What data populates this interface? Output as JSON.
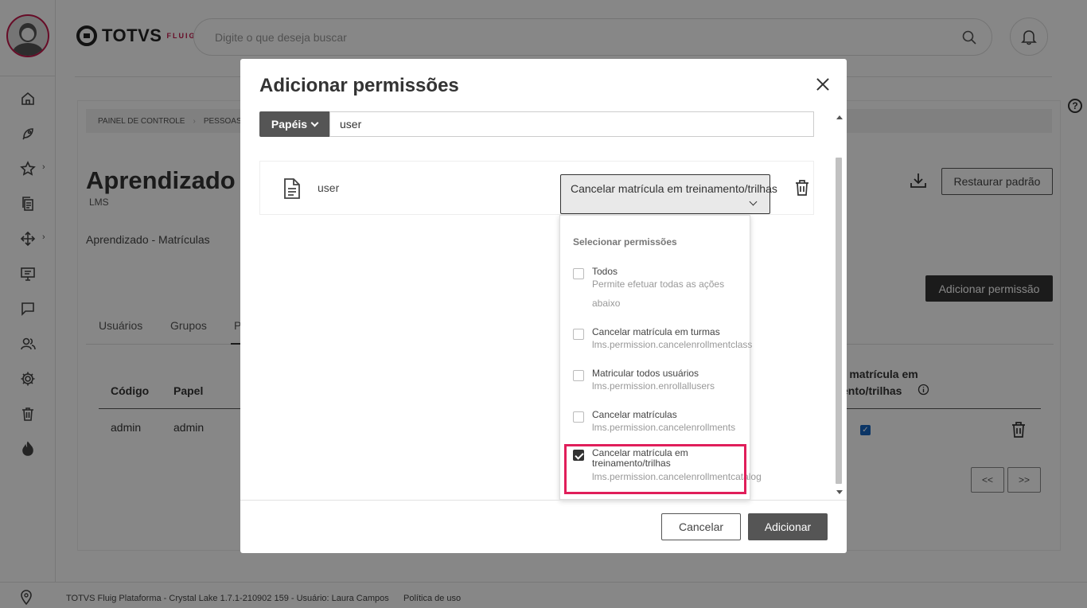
{
  "app": {
    "logo_text": "TOTVS",
    "logo_sub": "FLUIG",
    "search_placeholder": "Digite o que deseja buscar"
  },
  "sidebar": {
    "items": [
      {
        "icon": "home-icon"
      },
      {
        "icon": "rocket-icon"
      },
      {
        "icon": "star-icon",
        "has_submenu": true
      },
      {
        "icon": "documents-icon"
      },
      {
        "icon": "workflow-icon",
        "has_submenu": true
      },
      {
        "icon": "presentation-icon"
      },
      {
        "icon": "chat-icon"
      },
      {
        "icon": "people-icon"
      },
      {
        "icon": "gear-icon"
      },
      {
        "icon": "trash-icon"
      },
      {
        "icon": "flame-icon"
      }
    ]
  },
  "page": {
    "breadcrumb": [
      "PAINEL DE CONTROLE",
      "PESSOAS"
    ],
    "title": "Aprendizado",
    "subtitle": "LMS",
    "section": "Aprendizado - Matrículas",
    "restore_label": "Restaurar padrão",
    "add_permission_label": "Adicionar permissão",
    "tabs": [
      "Usuários",
      "Grupos",
      "P"
    ],
    "table": {
      "headers": [
        "Código",
        "Papel",
        "r matrícula em",
        "ento/trilhas"
      ],
      "rows": [
        {
          "code": "admin",
          "role": "admin"
        }
      ]
    },
    "pager": {
      "prev": "<<",
      "next": ">>"
    }
  },
  "footer": {
    "text": "TOTVS Fluig Plataforma - Crystal Lake 1.7.1-210902 159 - Usuário: Laura Campos",
    "link": "Política de uso"
  },
  "modal": {
    "title": "Adicionar permissões",
    "filter_button": "Papéis",
    "filter_value": "user",
    "row": {
      "label": "user",
      "selected_permission": "Cancelar matrícula em treinamento/trilhas"
    },
    "dropdown": {
      "title": "Selecionar permissões",
      "options": [
        {
          "label": "Todos",
          "desc": [
            "Permite efetuar todas as ações",
            "abaixo"
          ],
          "checked": false
        },
        {
          "label": "Cancelar matrícula em turmas",
          "desc": [
            "lms.permission.cancelenrollmentclass"
          ],
          "checked": false
        },
        {
          "label": "Matricular todos usuários",
          "desc": [
            "lms.permission.enrollallusers"
          ],
          "checked": false
        },
        {
          "label": "Cancelar matrículas",
          "desc": [
            "lms.permission.cancelenrollments"
          ],
          "checked": false
        },
        {
          "label": "Cancelar matrícula em treinamento/trilhas",
          "desc": [
            "lms.permission.cancelenrollmentcatalog"
          ],
          "checked": true
        }
      ]
    },
    "cancel_label": "Cancelar",
    "add_label": "Adicionar"
  },
  "colors": {
    "highlight": "#e01e5a",
    "avatar_ring": "#c2184b",
    "checkbox_blue": "#1565c0"
  }
}
